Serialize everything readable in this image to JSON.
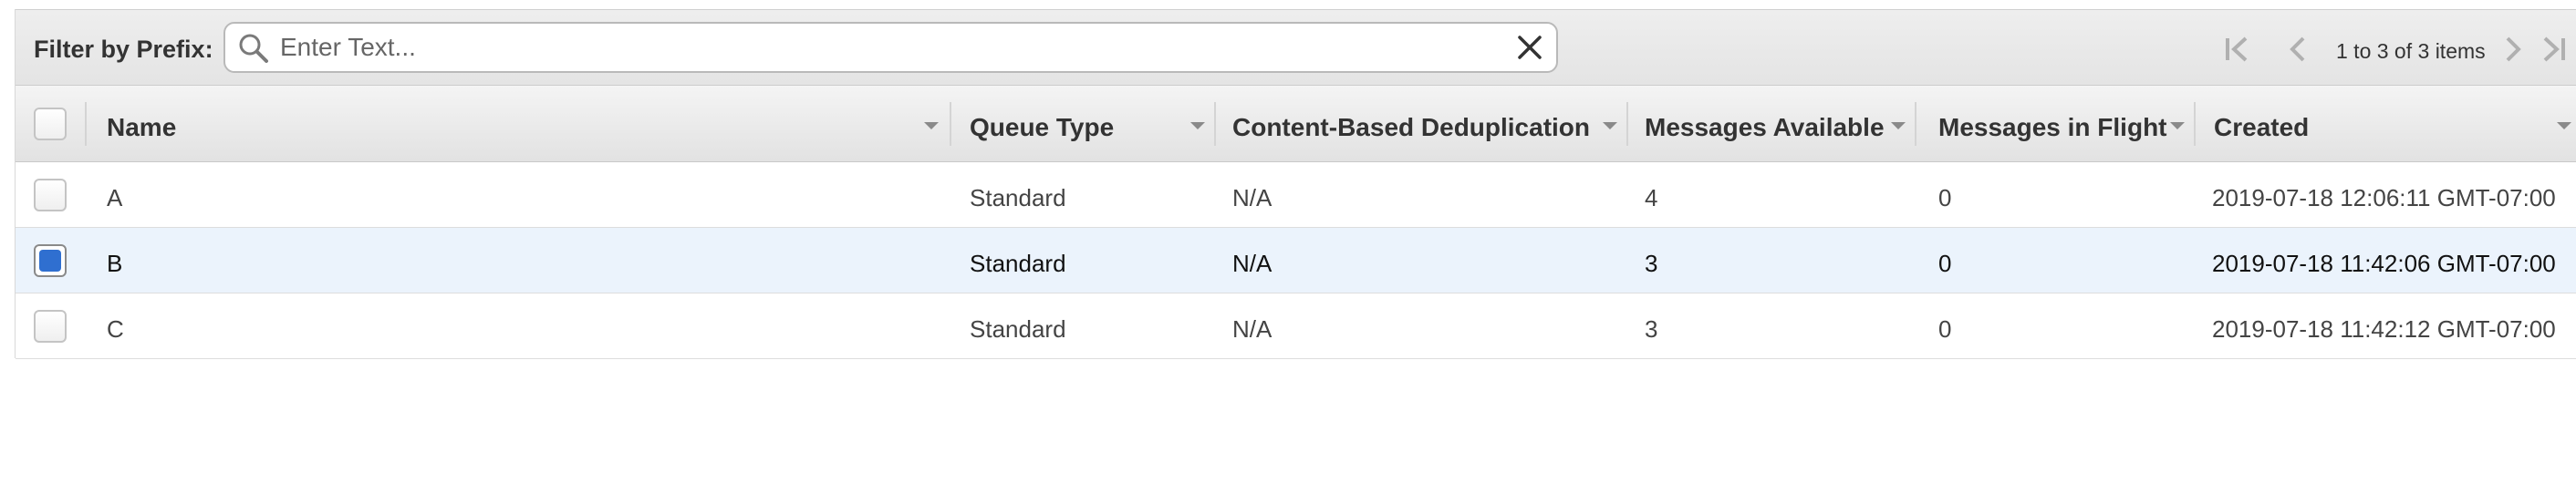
{
  "filter": {
    "label": "Filter by Prefix:",
    "placeholder": "Enter Text...",
    "value": ""
  },
  "pagination": {
    "text": "1 to 3 of 3 items"
  },
  "columns": [
    {
      "label": "Name"
    },
    {
      "label": "Queue Type"
    },
    {
      "label": "Content-Based Deduplication"
    },
    {
      "label": "Messages Available"
    },
    {
      "label": "Messages in Flight"
    },
    {
      "label": "Created"
    }
  ],
  "rows": [
    {
      "name": "A",
      "queue_type": "Standard",
      "dedup": "N/A",
      "available": "4",
      "in_flight": "0",
      "created": "2019-07-18 12:06:11 GMT-07:00",
      "selected": false
    },
    {
      "name": "B",
      "queue_type": "Standard",
      "dedup": "N/A",
      "available": "3",
      "in_flight": "0",
      "created": "2019-07-18 11:42:06 GMT-07:00",
      "selected": true
    },
    {
      "name": "C",
      "queue_type": "Standard",
      "dedup": "N/A",
      "available": "3",
      "in_flight": "0",
      "created": "2019-07-18 11:42:12 GMT-07:00",
      "selected": false
    }
  ],
  "colors": {
    "selected_row": "#ebf3fc",
    "checkbox_checked": "#2f6fd0",
    "header_bg": "#e8e8e8"
  },
  "icons": [
    "search-icon",
    "clear-icon",
    "first-page-icon",
    "previous-page-icon",
    "next-page-icon",
    "last-page-icon",
    "sort-arrow-icon"
  ]
}
